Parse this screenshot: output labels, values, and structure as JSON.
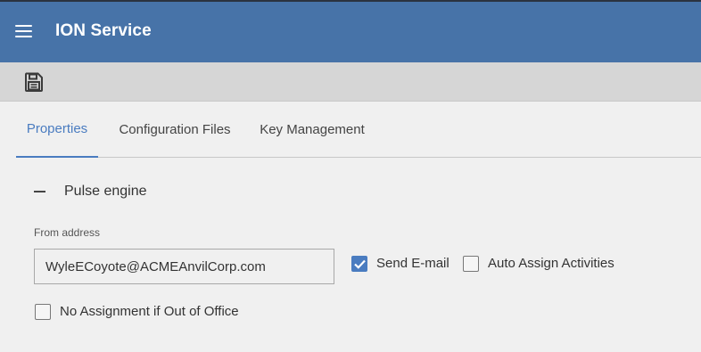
{
  "header": {
    "title": "ION Service"
  },
  "toolbar": {
    "save_icon": "save-icon"
  },
  "tabs": [
    {
      "label": "Properties",
      "active": true
    },
    {
      "label": "Configuration Files",
      "active": false
    },
    {
      "label": "Key Management",
      "active": false
    }
  ],
  "section": {
    "title": "Pulse engine",
    "collapse_icon": "minus-icon"
  },
  "form": {
    "from_address_label": "From address",
    "from_address_value": "WyleECoyote@ACMEAnvilCorp.com",
    "send_email_label": "Send E-mail",
    "send_email_checked": true,
    "auto_assign_label": "Auto Assign Activities",
    "auto_assign_checked": false,
    "no_assignment_label": "No Assignment if Out of Office",
    "no_assignment_checked": false
  },
  "colors": {
    "header_bg": "#4773a8",
    "accent": "#4a7cc0",
    "toolbar_bg": "#d6d6d6",
    "page_bg": "#f0f0f0"
  }
}
